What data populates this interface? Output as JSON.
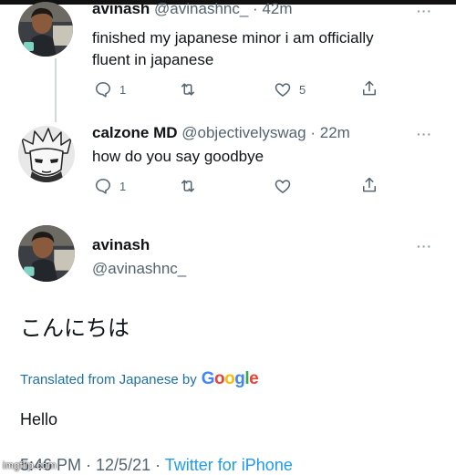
{
  "tweet1": {
    "name": "avinash",
    "handle": "@avinashnc_",
    "separator": "·",
    "time": "42m",
    "text_line1": "finished my japanese minor i am officially",
    "text_line2": "fluent in japanese",
    "reply_count": "1",
    "like_count": "5"
  },
  "tweet2": {
    "name": "calzone MD",
    "handle": "@objectivelyswag",
    "separator": "·",
    "time": "22m",
    "text": "how do you say goodbye",
    "reply_count": "1"
  },
  "tweet3": {
    "name": "avinash",
    "handle": "@avinashnc_",
    "text": "こんにちは",
    "translated_label": "Translated from Japanese by",
    "google": [
      "G",
      "o",
      "o",
      "g",
      "l",
      "e"
    ],
    "translation": "Hello",
    "timestamp": "5:46 PM · 12/5/21 ·",
    "source": "Twitter for iPhone"
  },
  "watermark": "imgflip.com",
  "colors": {
    "link_blue": "#1d9bf0",
    "translate_blue": "#1d70a8",
    "secondary_text": "#536471",
    "thread_line": "#cfd9de"
  },
  "icons": [
    "reply-icon",
    "retweet-icon",
    "like-icon",
    "share-icon",
    "more-icon"
  ]
}
